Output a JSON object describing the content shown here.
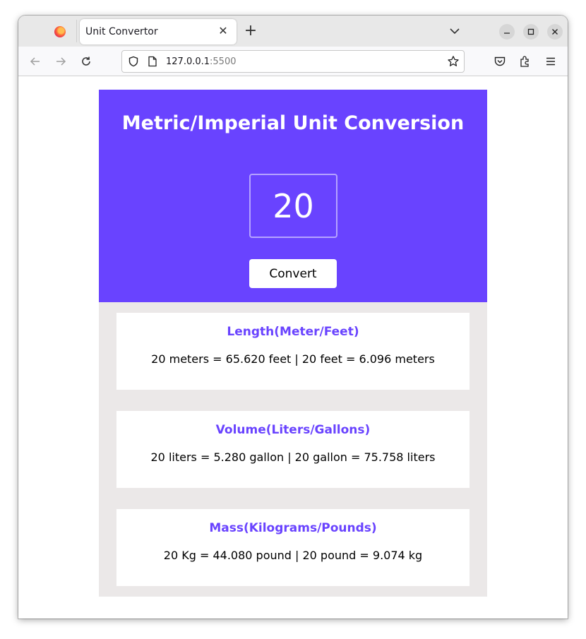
{
  "browser": {
    "tab_title": "Unit Convertor",
    "url_host": "127.0.0.1",
    "url_port": ":5500"
  },
  "app": {
    "title": "Metric/Imperial Unit Conversion",
    "input_value": "20",
    "convert_label": "Convert",
    "accent_color": "#6943ff",
    "cards": [
      {
        "title": "Length(Meter/Feet)",
        "result": "20 meters = 65.620 feet | 20 feet = 6.096 meters"
      },
      {
        "title": "Volume(Liters/Gallons)",
        "result": "20 liters = 5.280 gallon | 20 gallon = 75.758 liters"
      },
      {
        "title": "Mass(Kilograms/Pounds)",
        "result": "20 Kg = 44.080 pound | 20 pound = 9.074 kg"
      }
    ]
  }
}
